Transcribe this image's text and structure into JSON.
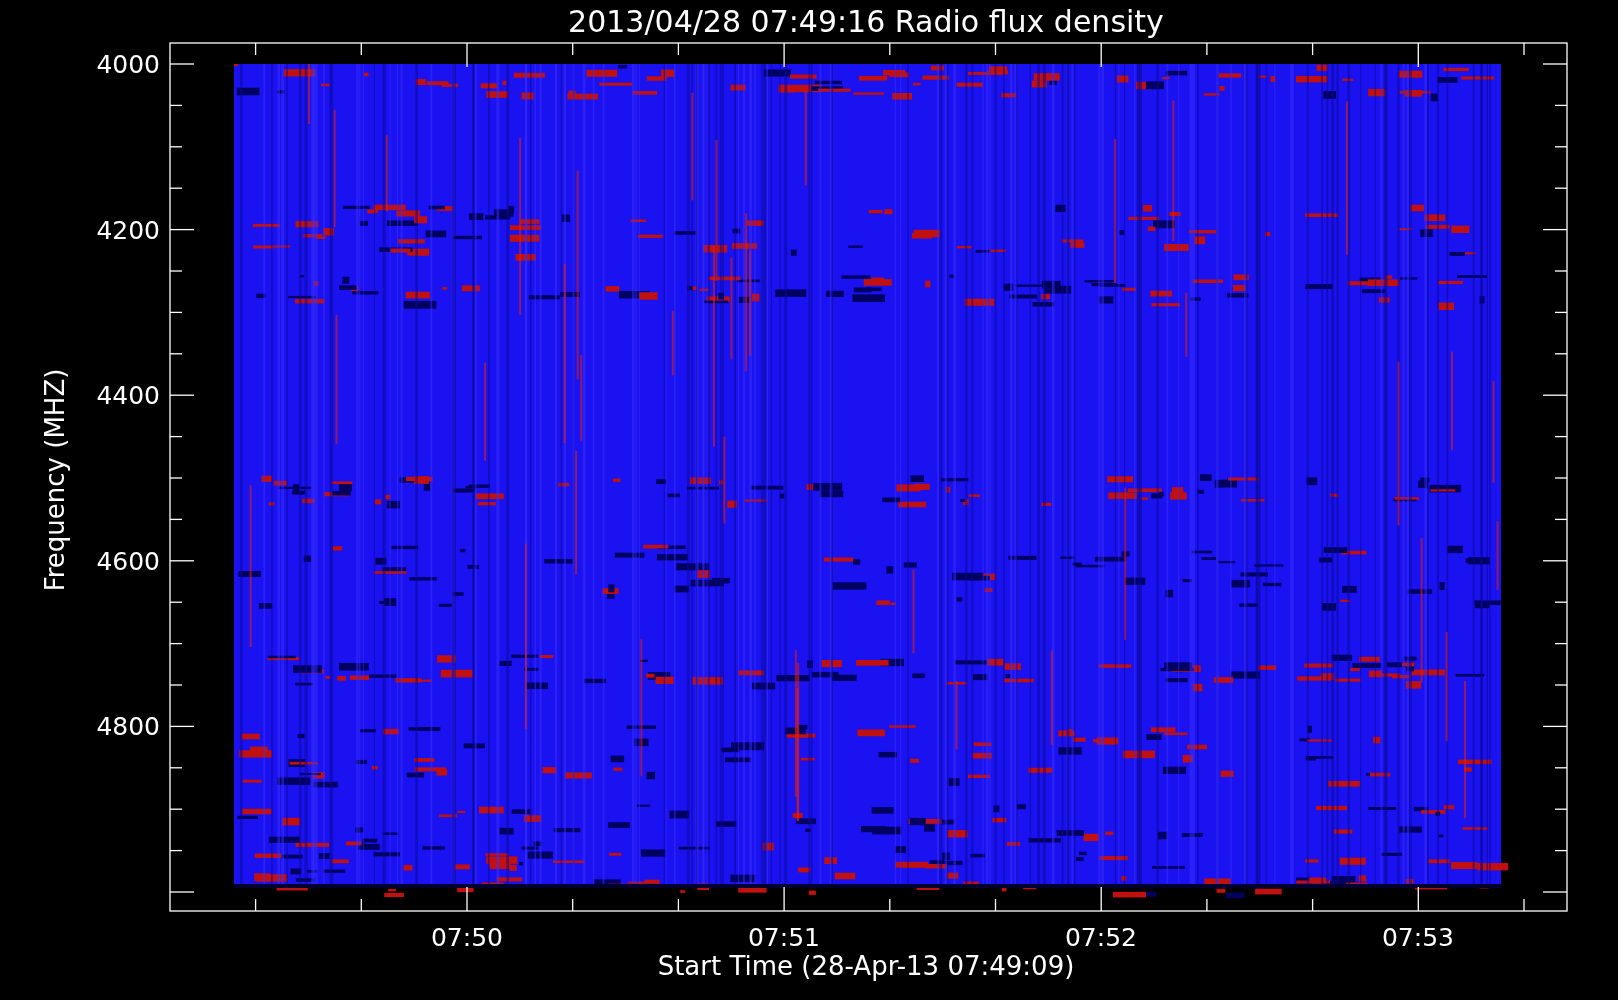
{
  "title": "2013/04/28 07:49:16 Radio flux density",
  "ylabel": "Frequency (MHZ)",
  "xlabel": "Start Time (28-Apr-13 07:49:09)",
  "yticks": [
    "4000",
    "4200",
    "4400",
    "4600",
    "4800"
  ],
  "xticks": [
    "07:50",
    "07:51",
    "07:52",
    "07:53"
  ]
}
